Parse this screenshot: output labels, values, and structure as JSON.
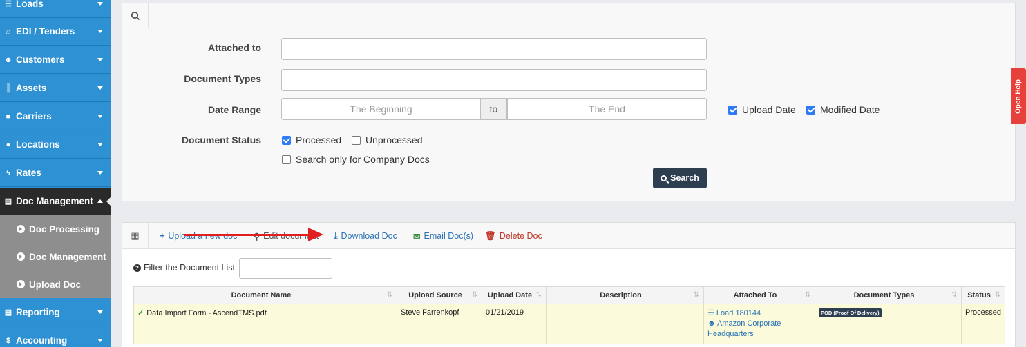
{
  "sidebar": {
    "items": [
      {
        "label": "Loads",
        "icon": "list-icon"
      },
      {
        "label": "EDI / Tenders",
        "icon": "inbox-icon"
      },
      {
        "label": "Customers",
        "icon": "users-icon"
      },
      {
        "label": "Assets",
        "icon": "barcode-icon"
      },
      {
        "label": "Carriers",
        "icon": "truck-icon"
      },
      {
        "label": "Locations",
        "icon": "map-marker-icon"
      },
      {
        "label": "Rates",
        "icon": "bolt-icon"
      },
      {
        "label": "Doc Management",
        "icon": "file-icon"
      },
      {
        "label": "Reporting",
        "icon": "file-icon"
      },
      {
        "label": "Accounting",
        "icon": "dollar-icon"
      }
    ],
    "subitems": [
      {
        "label": "Doc Processing"
      },
      {
        "label": "Doc Management"
      },
      {
        "label": "Upload Doc"
      }
    ]
  },
  "search": {
    "attached_to_label": "Attached to",
    "document_types_label": "Document Types",
    "date_range_label": "Date Range",
    "date_from_placeholder": "The Beginning",
    "date_to_label": "to",
    "date_to_placeholder": "The End",
    "upload_date_label": "Upload Date",
    "modified_date_label": "Modified Date",
    "document_status_label": "Document Status",
    "processed_label": "Processed",
    "unprocessed_label": "Unprocessed",
    "company_docs_label": "Search only for Company Docs",
    "search_button": "Search"
  },
  "help": {
    "label": "Open Help"
  },
  "toolbar": {
    "upload_label": "Upload a new doc",
    "edit_label": "Edit document",
    "download_label": "Download Doc",
    "email_label": "Email Doc(s)",
    "delete_label": "Delete Doc"
  },
  "filter": {
    "label": "Filter the Document List:",
    "value": ""
  },
  "table": {
    "headers": [
      "Document Name",
      "Upload Source",
      "Upload Date",
      "Description",
      "Attached To",
      "Document Types",
      "Status"
    ],
    "rows": [
      {
        "document_name": "Data Import Form - AscendTMS.pdf",
        "upload_source": "Steve Farrenkopf",
        "upload_date": "01/21/2019",
        "description": "",
        "attached_load": "Load 180144",
        "attached_customer": "Amazon Corporate Headquarters",
        "document_type": "POD (Proof Of Delivery)",
        "status": "Processed"
      }
    ]
  },
  "colors": {
    "sidebar_blue": "#2d91d3",
    "accent_red": "#e8403a",
    "dark_navy": "#2c3e50",
    "row_highlight": "#fbfbdb"
  }
}
